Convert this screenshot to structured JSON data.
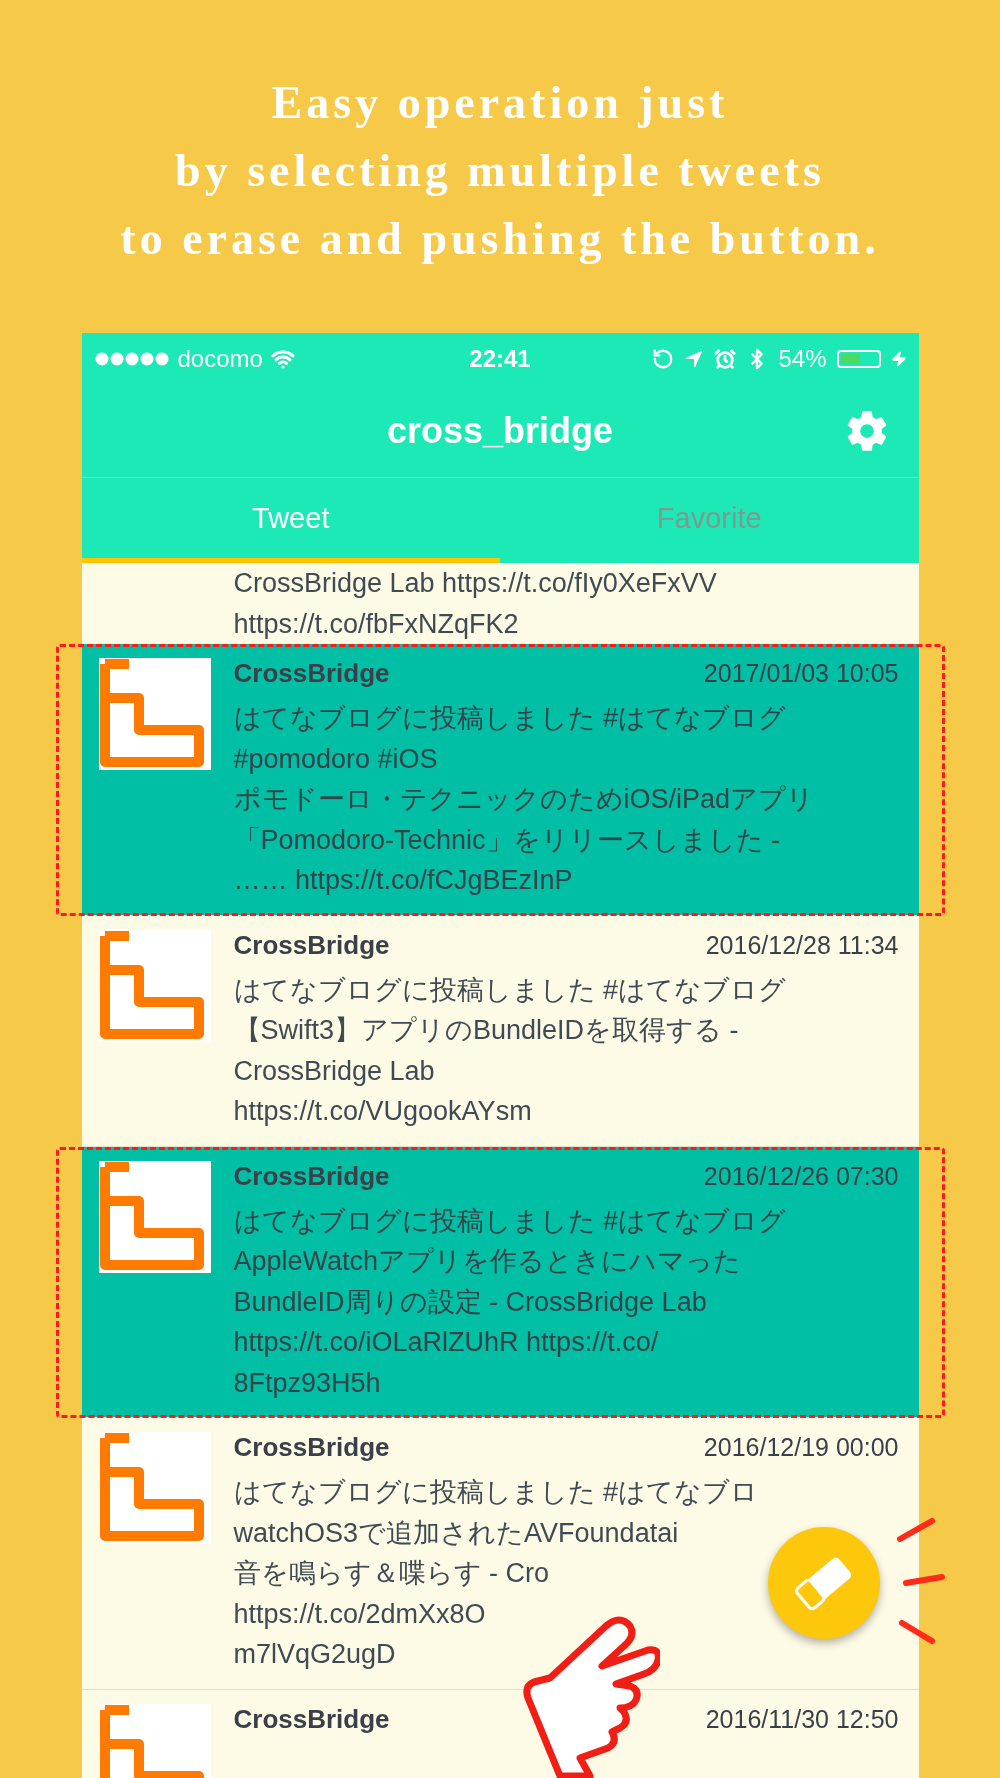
{
  "headline": [
    "Easy operation just",
    "by selecting multiple tweets",
    "to erase and pushing the button."
  ],
  "status_bar": {
    "carrier": "docomo",
    "time": "22:41",
    "battery": "54%"
  },
  "nav": {
    "title": "cross_bridge"
  },
  "tabs": [
    {
      "label": "Tweet",
      "selected": true
    },
    {
      "label": "Favorite",
      "selected": false
    }
  ],
  "partial_tweet": {
    "lines": [
      "CrossBridge Lab https://t.co/fIy0XeFxVV",
      "https://t.co/fbFxNZqFK2"
    ]
  },
  "tweets": [
    {
      "name": "CrossBridge",
      "date": "2017/01/03 10:05",
      "selected": true,
      "lines": [
        "はてなブログに投稿しました #はてなブログ",
        "#pomodoro #iOS",
        "ポモドーロ・テクニックのためiOS/iPadアプリ",
        "「Pomodoro-Technic」をリリースしました -",
        "…… https://t.co/fCJgBEzInP"
      ]
    },
    {
      "name": "CrossBridge",
      "date": "2016/12/28 11:34",
      "selected": false,
      "lines": [
        "はてなブログに投稿しました #はてなブログ",
        "【Swift3】アプリのBundleIDを取得する -",
        "CrossBridge Lab",
        "https://t.co/VUgookAYsm"
      ]
    },
    {
      "name": "CrossBridge",
      "date": "2016/12/26 07:30",
      "selected": true,
      "lines": [
        "はてなブログに投稿しました #はてなブログ",
        "AppleWatchアプリを作るときにハマった",
        "BundleID周りの設定 - CrossBridge Lab",
        "https://t.co/iOLaRlZUhR https://t.co/",
        "8Ftpz93H5h"
      ]
    },
    {
      "name": "CrossBridge",
      "date": "2016/12/19 00:00",
      "selected": false,
      "lines": [
        "はてなブログに投稿しました #はてなブロ",
        "watchOS3で追加されたAVFoundatai",
        "音を鳴らす＆喋らす - Cro",
        "https://t.co/2dmXx8O",
        "m7lVqG2ugD"
      ]
    },
    {
      "name": "CrossBridge",
      "date": "2016/11/30 12:50",
      "selected": false
    }
  ]
}
